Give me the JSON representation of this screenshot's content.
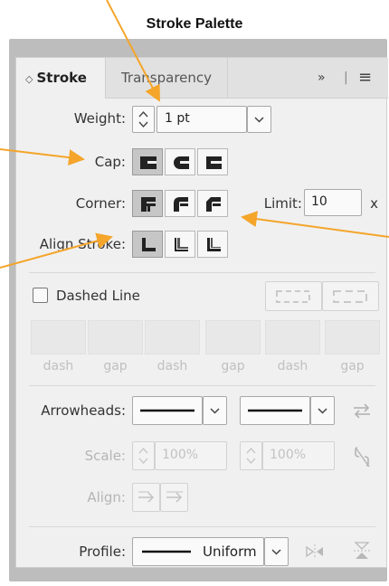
{
  "caption": "Stroke Palette",
  "tabs": {
    "stroke": "Stroke",
    "transparency": "Transparency",
    "more": "»",
    "menu": "≡"
  },
  "weight": {
    "label": "Weight:",
    "value": "1 pt"
  },
  "cap": {
    "label": "Cap:"
  },
  "corner": {
    "label": "Corner:",
    "limit_label": "Limit:",
    "limit_value": "10",
    "limit_unit": "x"
  },
  "align_stroke": {
    "label": "Align Stroke:"
  },
  "dashed": {
    "label": "Dashed Line",
    "checked": false,
    "cells": [
      "dash",
      "gap",
      "dash",
      "gap",
      "dash",
      "gap"
    ]
  },
  "arrowheads": {
    "label": "Arrowheads:"
  },
  "scale": {
    "label": "Scale:",
    "start_value": "100%",
    "end_value": "100%"
  },
  "align": {
    "label": "Align:"
  },
  "profile": {
    "label": "Profile:",
    "value": "Uniform"
  },
  "colors": {
    "accent": "#f4a52a",
    "selected_button": "#c6c6c6",
    "panel": "#f0f0f0"
  }
}
